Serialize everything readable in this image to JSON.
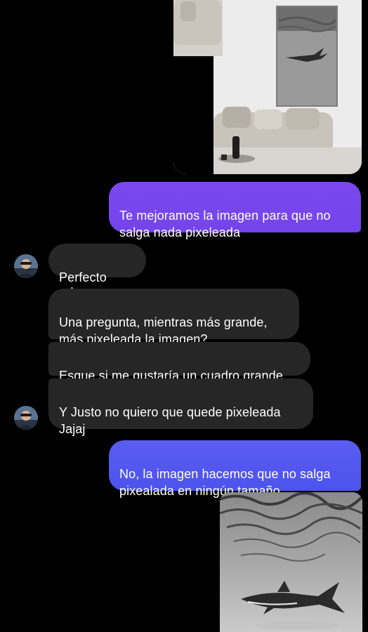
{
  "messages": {
    "outgoing_1": "Te mejoramos la imagen para que no\nsalga nada pixeleada",
    "incoming_1": "Perfecto",
    "incoming_1_emoji": "ok-hand-emoji",
    "incoming_2": "Una pregunta, mientras más grande,\nmás pixeleada la imagen?",
    "incoming_3": "Esque si me gustaría un cuadro grande",
    "incoming_4": "Y Justo no quiero que quede pixeleada\nJajaj",
    "outgoing_2": "No, la imagen hacemos que no salga\npixealada en ningún tamaño"
  },
  "icons": {
    "avatar": "contact-avatar",
    "emoji": "ok-hand-emoji"
  },
  "colors": {
    "background": "#000000",
    "incoming_bubble": "#262626",
    "outgoing_bubble_top": "#7a46ee",
    "outgoing_bubble_bottom": "#5158ef",
    "text": "#ffffff"
  }
}
